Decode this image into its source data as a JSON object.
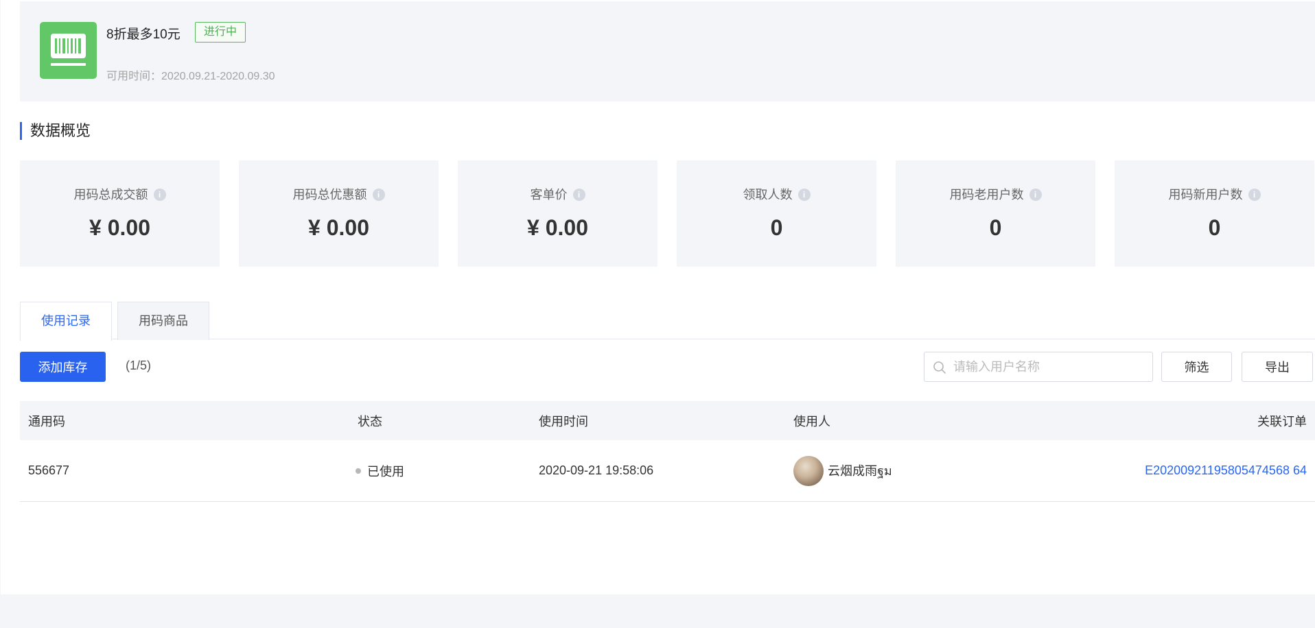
{
  "coupon": {
    "name": "8折最多10元",
    "status_badge": "进行中",
    "available_time": "可用时间：2020.09.21-2020.09.30",
    "icon": "barcode-icon",
    "icon_color": "#62c767"
  },
  "overview": {
    "title": "数据概览",
    "stats": [
      {
        "label": "用码总成交额",
        "value": "¥ 0.00"
      },
      {
        "label": "用码总优惠额",
        "value": "¥ 0.00"
      },
      {
        "label": "客单价",
        "value": "¥ 0.00"
      },
      {
        "label": "领取人数",
        "value": "0"
      },
      {
        "label": "用码老用户数",
        "value": "0"
      },
      {
        "label": "用码新用户数",
        "value": "0"
      }
    ],
    "info_icon": "info-icon"
  },
  "tabs": [
    {
      "label": "使用记录",
      "active": true
    },
    {
      "label": "用码商品",
      "active": false
    }
  ],
  "toolbar": {
    "add_stock_label": "添加库存",
    "count_text": "(1/5)",
    "search_placeholder": "请输入用户名称",
    "search_value": "",
    "filter_label": "筛选",
    "export_label": "导出"
  },
  "table": {
    "headers": [
      "通用码",
      "状态",
      "使用时间",
      "使用人",
      "关联订单"
    ],
    "rows": [
      {
        "code": "556677",
        "status": "已使用",
        "use_time": "2020-09-21 19:58:06",
        "user": "云烟成雨ฐม",
        "order": "E20200921195805474568 64"
      }
    ]
  },
  "colors": {
    "accent": "#2a66f0",
    "primary_button": "#2a62f0",
    "badge_green": "#4cae51",
    "card_bg": "#f4f5f9"
  }
}
